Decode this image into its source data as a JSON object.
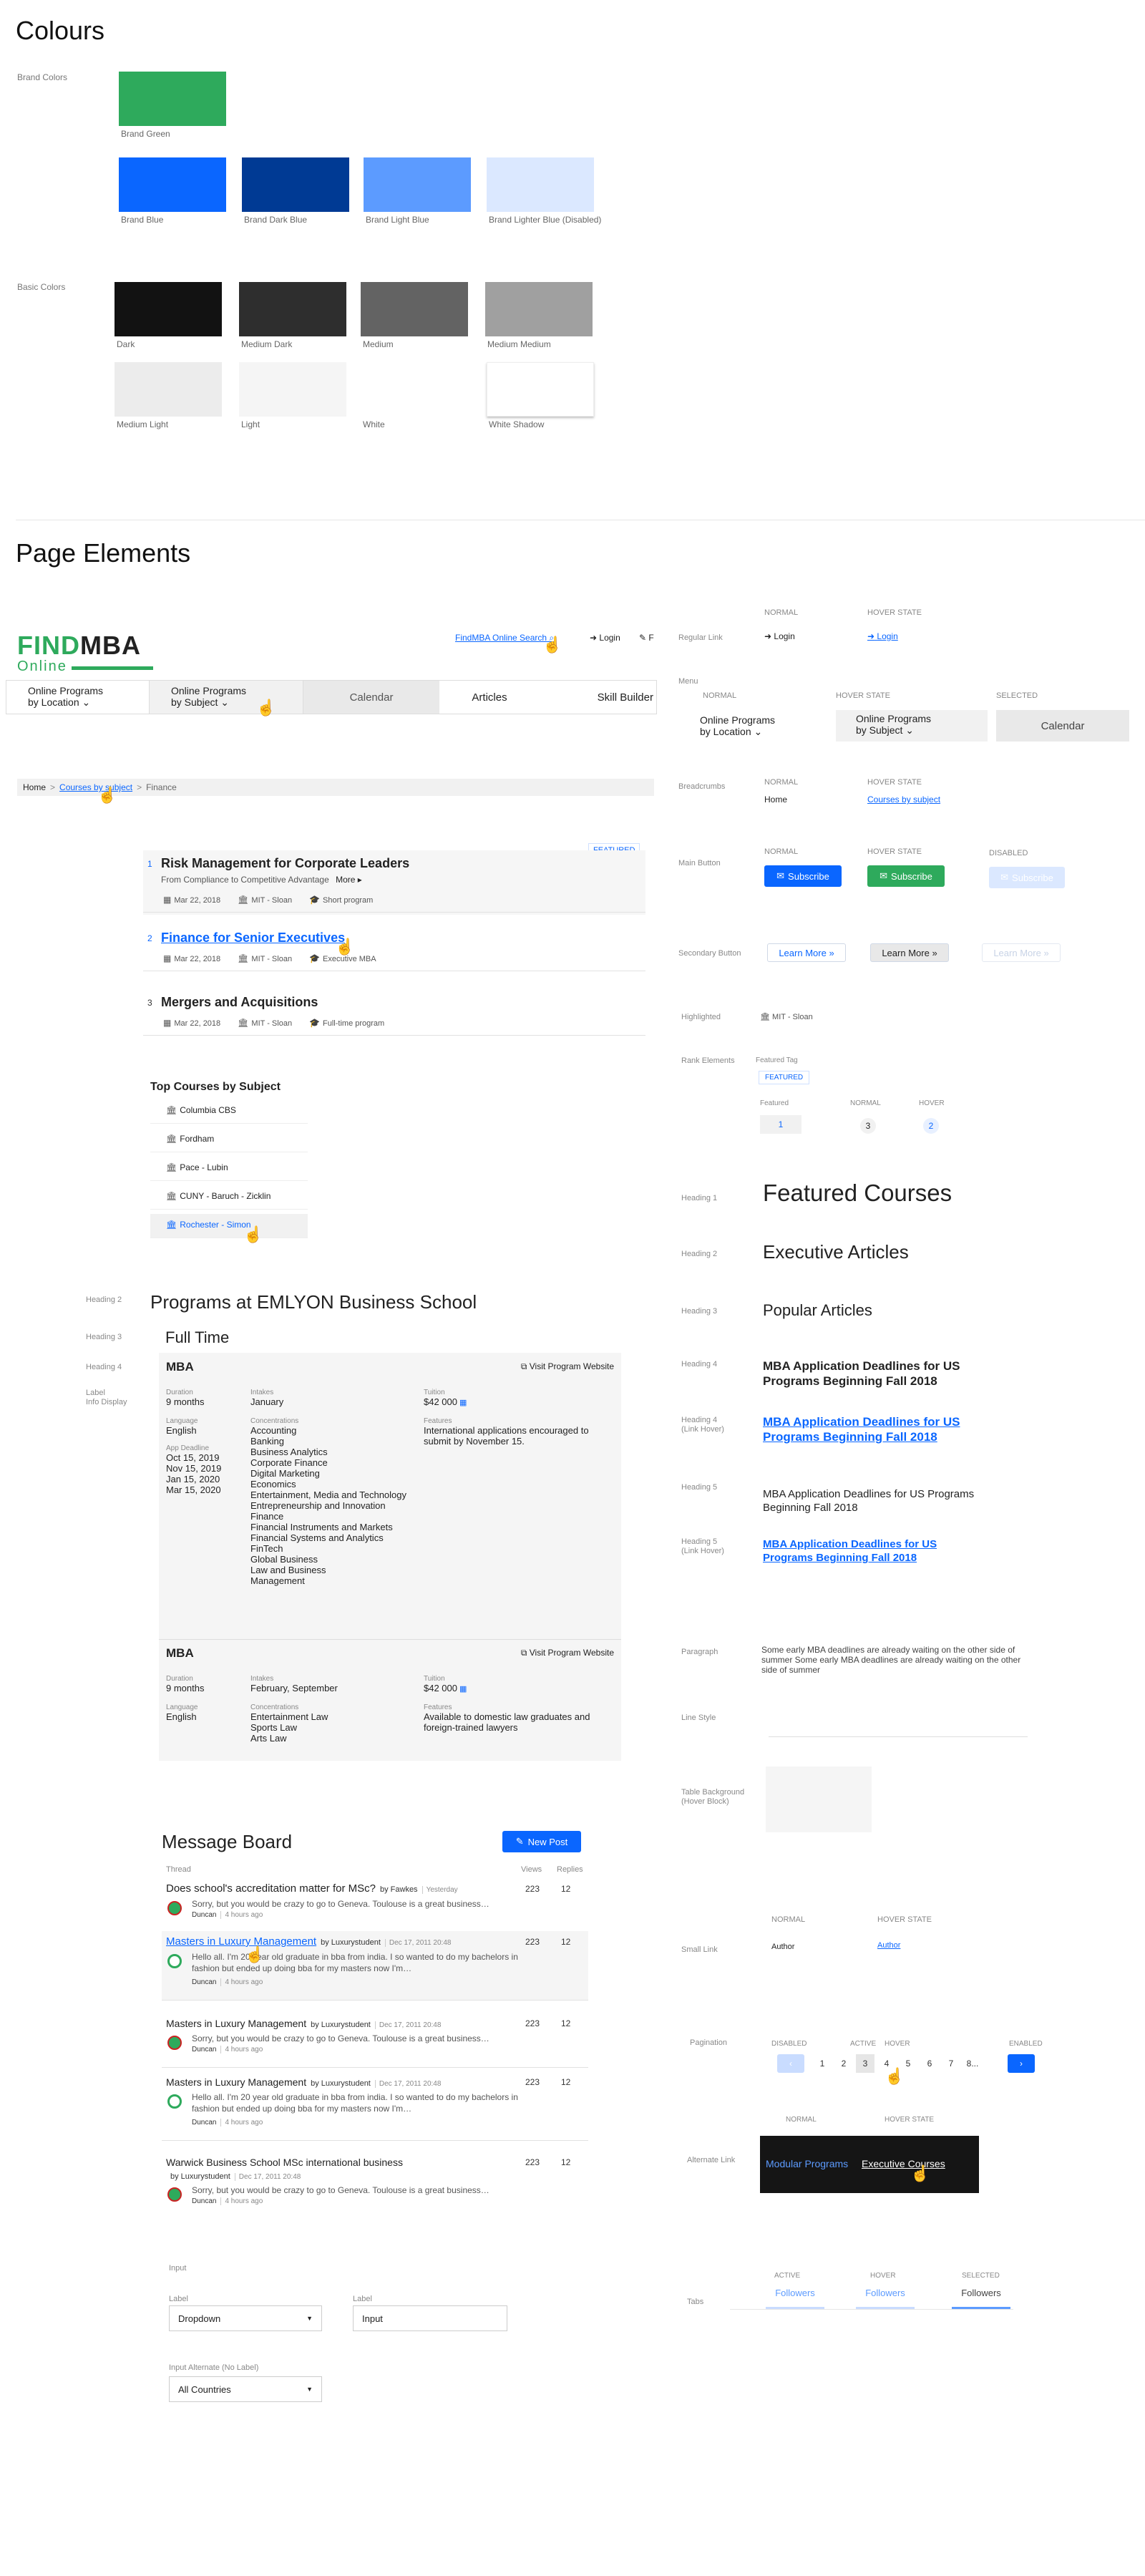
{
  "colours": {
    "title": "Colours",
    "brand_label": "Brand Colors",
    "basic_label": "Basic Colors",
    "brand": [
      {
        "name": "Brand Green",
        "hex": "#2eaa5c"
      },
      {
        "name": "Brand Blue",
        "hex": "#0a66ff"
      },
      {
        "name": "Brand Dark Blue",
        "hex": "#003a94"
      },
      {
        "name": "Brand Light Blue",
        "hex": "#5c9bff"
      },
      {
        "name": "Brand Lighter Blue (Disabled)",
        "hex": "#dbe8ff"
      }
    ],
    "basic": [
      {
        "name": "Dark",
        "hex": "#121212"
      },
      {
        "name": "Medium Dark",
        "hex": "#2e2e2e"
      },
      {
        "name": "Medium",
        "hex": "#636363"
      },
      {
        "name": "Medium Medium",
        "hex": "#a0a0a0"
      },
      {
        "name": "Medium  Light",
        "hex": "#ececec"
      },
      {
        "name": "Light",
        "hex": "#f5f5f5"
      },
      {
        "name": "White",
        "hex": "#ffffff"
      },
      {
        "name": "White Shadow",
        "hex": "#ffffff"
      }
    ]
  },
  "page_elements": {
    "title": "Page Elements"
  },
  "header": {
    "logo_find": "FIND",
    "logo_mba": "MBA",
    "logo_online": "Online",
    "search_link": "FindMBA Online Search",
    "login": "Login",
    "extra": "F",
    "nav": [
      {
        "l1": "Online Programs",
        "l2": "by Location"
      },
      {
        "l1": "Online Programs",
        "l2": "by Subject"
      },
      {
        "l1": "Calendar",
        "l2": ""
      },
      {
        "l1": "Articles",
        "l2": ""
      },
      {
        "l1": "Skill Builder",
        "l2": ""
      }
    ]
  },
  "breadcrumb": {
    "home": "Home",
    "sep": ">",
    "subject": "Courses by subject",
    "current": "Finance"
  },
  "courses": {
    "featured_tag": "FEATURED",
    "items": [
      {
        "rank": "1",
        "title": "Risk Management for Corporate Leaders",
        "sub": "From Compliance to Competitive Advantage",
        "more": "More",
        "date": "Mar 22, 2018",
        "school": "MIT - Sloan",
        "type": "Short program"
      },
      {
        "rank": "2",
        "title": "Finance for Senior Executives",
        "sub": "",
        "more": "",
        "date": "Mar 22, 2018",
        "school": "MIT - Sloan",
        "type": "Executive MBA"
      },
      {
        "rank": "3",
        "title": "Mergers and Acquisitions",
        "sub": "",
        "more": "",
        "date": "Mar 22, 2018",
        "school": "MIT - Sloan",
        "type": "Full-time program"
      }
    ]
  },
  "top_courses": {
    "title": "Top Courses by Subject",
    "items": [
      "Columbia CBS",
      "Fordham",
      "Pace - Lubin",
      "CUNY - Baruch - Zicklin",
      "Rochester - Simon"
    ]
  },
  "programs": {
    "h2_label": "Heading 2",
    "h3_label": "Heading 3",
    "h4_label": "Heading 4",
    "info_label": "Label\nInfo Display",
    "title": "Programs at EMLYON Business School",
    "subtitle": "Full Time",
    "cards": [
      {
        "name": "MBA",
        "link": "Visit Program Website",
        "duration_l": "Duration",
        "duration": "9 months",
        "intakes_l": "Intakes",
        "intakes": "January",
        "tuition_l": "Tuition",
        "tuition": "$42 000",
        "language_l": "Language",
        "language": "English",
        "conc_l": "Concentrations",
        "conc": [
          "Accounting",
          "Banking",
          "Business Analytics",
          "Corporate Finance",
          "Digital Marketing",
          "Economics",
          "Entertainment, Media and Technology",
          "Entrepreneurship and Innovation",
          "Finance",
          "Financial Instruments and Markets",
          "Financial Systems and Analytics",
          "FinTech",
          "Global Business",
          "Law and Business",
          "Management"
        ],
        "features_l": "Features",
        "features": "International applications encouraged to submit by November 15.",
        "deadline_l": "App Deadline",
        "deadlines": [
          "Oct 15, 2019",
          "Nov 15, 2019",
          "Jan 15, 2020",
          "Mar 15, 2020"
        ]
      },
      {
        "name": "MBA",
        "link": "Visit Program Website",
        "duration_l": "Duration",
        "duration": "9 months",
        "intakes_l": "Intakes",
        "intakes": "February, September",
        "tuition_l": "Tuition",
        "tuition": "$42 000",
        "language_l": "Language",
        "language": "English",
        "conc_l": "Concentrations",
        "conc": [
          "Entertainment Law",
          "Sports Law",
          "Arts Law"
        ],
        "features_l": "Features",
        "features": "Available to domestic law graduates and foreign-trained lawyers"
      }
    ]
  },
  "board": {
    "title": "Message Board",
    "new_post": "New Post",
    "col_thread": "Thread",
    "col_views": "Views",
    "col_replies": "Replies",
    "threads": [
      {
        "topic": "Does school's accreditation matter for MSc?",
        "by": "by Fawkes",
        "date": "Yesterday",
        "snippet": "Sorry, but you would be crazy to go to Geneva. Toulouse is a great business…",
        "user": "Duncan",
        "ago": "4 hours ago",
        "views": "223",
        "replies": "12"
      },
      {
        "topic": "Masters in Luxury Management",
        "by": "by Luxurystudent",
        "date": "Dec 17, 2011 20:48",
        "snippet": "Hello all. I'm 20 year old graduate in bba from india. I so wanted to do my bachelors in fashion but ended up doing bba for my masters now I'm…",
        "user": "Duncan",
        "ago": "4 hours ago",
        "views": "223",
        "replies": "12"
      },
      {
        "topic": "Masters in Luxury Management",
        "by": "by Luxurystudent",
        "date": "Dec 17, 2011 20:48",
        "snippet": "Sorry, but you would be crazy to go to Geneva. Toulouse is a great business…",
        "user": "Duncan",
        "ago": "4 hours ago",
        "views": "223",
        "replies": "12"
      },
      {
        "topic": "Masters in Luxury Management",
        "by": "by Luxurystudent",
        "date": "Dec 17, 2011 20:48",
        "snippet": "Hello all. I'm 20 year old graduate in bba from india. I so wanted to do my bachelors in fashion but ended up doing bba for my masters now I'm…",
        "user": "Duncan",
        "ago": "4 hours ago",
        "views": "223",
        "replies": "12"
      },
      {
        "topic": "Warwick Business School MSc international business",
        "by": "by Luxurystudent",
        "date": "Dec 17, 2011 20:48",
        "snippet": "Sorry, but you would be crazy to go to Geneva. Toulouse is a great business…",
        "user": "Duncan",
        "ago": "4 hours ago",
        "views": "223",
        "replies": "12"
      }
    ]
  },
  "inputs": {
    "section": "Input",
    "label1": "Label",
    "dropdown": "Dropdown",
    "label2": "Label",
    "input": "Input",
    "alt_label": "Input Alternate (No Label)",
    "countries": "All Countries"
  },
  "right": {
    "normal": "NORMAL",
    "hover": "HOVER STATE",
    "selected": "SELECTED",
    "disabled": "DISABLED",
    "regular_link": "Regular Link",
    "login": "Login",
    "menu": "Menu",
    "menu_l1": "Online Programs",
    "menu_l2": "by Location",
    "menu_h1": "Online Programs",
    "menu_h2": "by Subject",
    "menu_sel": "Calendar",
    "breadcrumbs": "Breadcrumbs",
    "bc_home": "Home",
    "bc_link": "Courses by subject",
    "main_button": "Main Button",
    "subscribe": "Subscribe",
    "secondary_button": "Secondary Button",
    "learn_more": "Learn More",
    "highlighted": "Highlighted",
    "hl_value": "MIT - Sloan",
    "rank_elements": "Rank Elements",
    "featured_tag_label": "Featured Tag",
    "featured": "FEATURED",
    "rank_featured": "Featured",
    "rank_normal": "NORMAL",
    "rank_hover": "HOVER",
    "r1": "1",
    "r3": "3",
    "r2": "2",
    "heading1_label": "Heading 1",
    "heading1": "Featured Courses",
    "heading2_label": "Heading 2",
    "heading2": "Executive Articles",
    "heading3_label": "Heading 3",
    "heading3": "Popular Articles",
    "heading4_label": "Heading 4",
    "heading4": "MBA Application Deadlines for US Programs Beginning Fall 2018",
    "heading4h_label": "Heading 4\n(Link Hover)",
    "heading4h": "MBA Application Deadlines for US Programs Beginning Fall 2018",
    "heading5_label": "Heading 5",
    "heading5": "MBA Application Deadlines for US Programs Beginning Fall 2018",
    "heading5h_label": "Heading 5\n(Link Hover)",
    "heading5h": "MBA Application Deadlines for US Programs Beginning Fall 2018",
    "paragraph_label": "Paragraph",
    "paragraph": "Some early MBA deadlines are already waiting on the other side of summer Some early MBA deadlines are already waiting on the other side of summer",
    "line_style": "Line Style",
    "table_bg": "Table Background\n(Hover Block)",
    "small_link": "Small Link",
    "author": "Author",
    "pagination": "Pagination",
    "pg_active": "ACTIVE",
    "pg_hover": "HOVER",
    "pg_enabled": "ENABLED",
    "pages": [
      "1",
      "2",
      "3",
      "4",
      "5",
      "6",
      "7",
      "8..."
    ],
    "alternate_link": "Alternate Link",
    "alt_normal": "Modular Programs",
    "alt_hover": "Executive Courses",
    "tabs": "Tabs",
    "tab_active": "ACTIVE",
    "tab_hover": "HOVER",
    "tab_selected": "SELECTED",
    "followers": "Followers"
  }
}
